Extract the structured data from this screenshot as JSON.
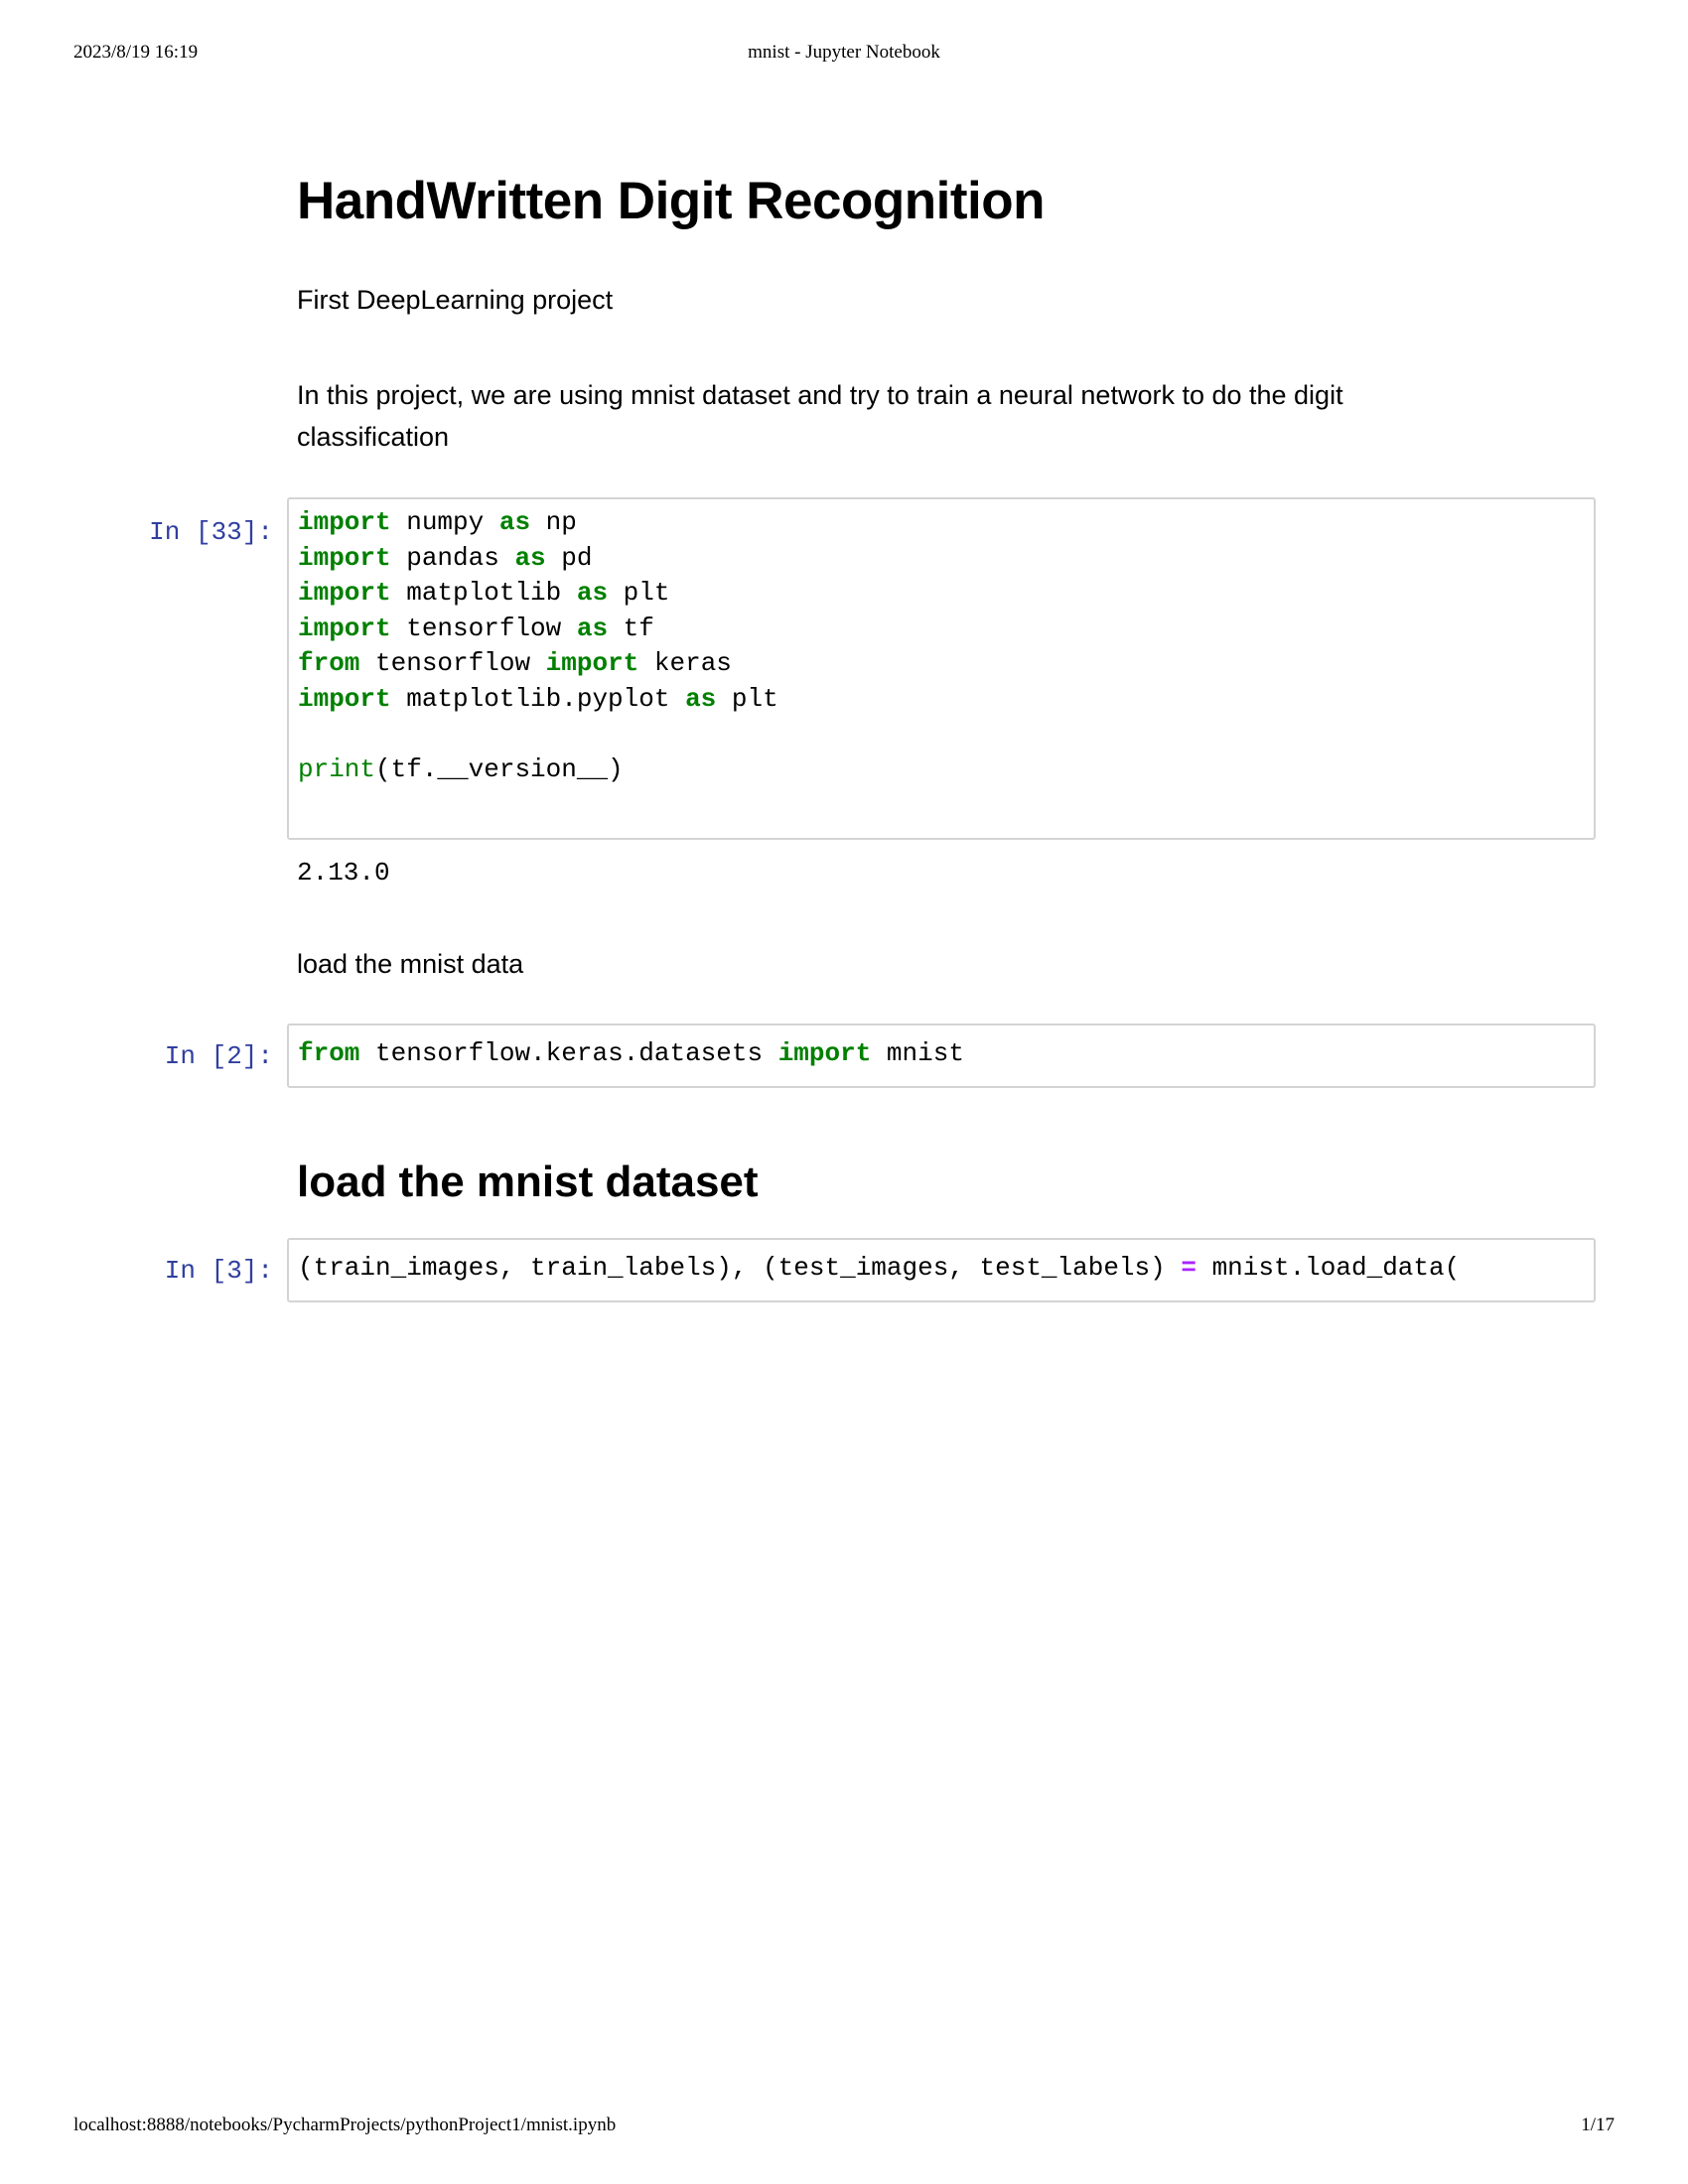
{
  "print_header": {
    "datetime": "2023/8/19 16:19",
    "doc_title": "mnist - Jupyter Notebook"
  },
  "notebook": {
    "title": "HandWritten Digit Recognition",
    "subtitle": "First DeepLearning project",
    "intro_line1": "In this project, we are using mnist dataset and try to train a neural network to do the digit",
    "intro_line2": "classification",
    "cell1": {
      "prompt": "In [33]:",
      "lines": [
        [
          [
            "kw",
            "import"
          ],
          [
            "t",
            " numpy "
          ],
          [
            "kw",
            "as"
          ],
          [
            "t",
            " np"
          ]
        ],
        [
          [
            "kw",
            "import"
          ],
          [
            "t",
            " pandas "
          ],
          [
            "kw",
            "as"
          ],
          [
            "t",
            " pd"
          ]
        ],
        [
          [
            "kw",
            "import"
          ],
          [
            "t",
            " matplotlib "
          ],
          [
            "kw",
            "as"
          ],
          [
            "t",
            " plt"
          ]
        ],
        [
          [
            "kw",
            "import"
          ],
          [
            "t",
            " tensorflow "
          ],
          [
            "kw",
            "as"
          ],
          [
            "t",
            " tf"
          ]
        ],
        [
          [
            "kw",
            "from"
          ],
          [
            "t",
            " tensorflow "
          ],
          [
            "kw",
            "import"
          ],
          [
            "t",
            " keras"
          ]
        ],
        [
          [
            "kw",
            "import"
          ],
          [
            "t",
            " matplotlib.pyplot "
          ],
          [
            "kw",
            "as"
          ],
          [
            "t",
            " plt"
          ]
        ],
        [],
        [
          [
            "bi",
            "print"
          ],
          [
            "t",
            "(tf.__version__)"
          ]
        ]
      ],
      "output": "2.13.0"
    },
    "md2": "load the mnist data",
    "cell2": {
      "prompt": "In [2]:",
      "lines": [
        [
          [
            "kw",
            "from"
          ],
          [
            "t",
            " tensorflow.keras.datasets "
          ],
          [
            "kw",
            "import"
          ],
          [
            "t",
            " mnist"
          ]
        ]
      ]
    },
    "heading2": "load the mnist dataset",
    "cell3": {
      "prompt": "In [3]:",
      "lines": [
        [
          [
            "t",
            "(train_images, train_labels), (test_images, test_labels) "
          ],
          [
            "op",
            "="
          ],
          [
            "t",
            " mnist.load_data("
          ]
        ]
      ]
    }
  },
  "print_footer": {
    "url": "localhost:8888/notebooks/PycharmProjects/pythonProject1/mnist.ipynb",
    "page": "1/17"
  },
  "colors": {
    "keyword": "#008000",
    "builtin": "#008000",
    "operator": "#aa22ff",
    "prompt": "#303f9f",
    "cell_border": "#d4d4d4"
  }
}
